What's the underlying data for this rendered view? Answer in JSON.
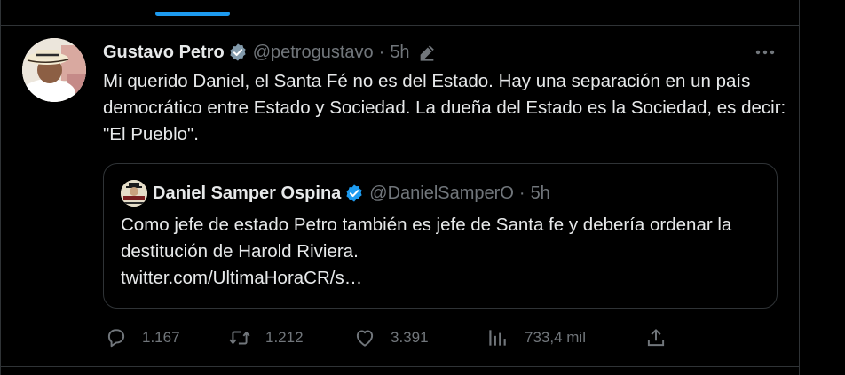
{
  "tweet": {
    "author_name": "Gustavo Petro",
    "handle": "@petrogustavo",
    "separator": "·",
    "time": "5h",
    "text": "Mi querido Daniel, el Santa Fé no es del Estado. Hay una separación en un país democrático entre Estado y Sociedad. La dueña del Estado es la Sociedad, es decir: \"El Pueblo\".",
    "icons": {
      "verified": "verified-badge-icon",
      "edited": "edit-pencil-icon",
      "more": "more-options-icon"
    }
  },
  "quote": {
    "author_name": "Daniel Samper Ospina",
    "handle": "@DanielSamperO",
    "separator": "·",
    "time": "5h",
    "text": "Como jefe de estado Petro también es jefe de Santa fe y debería ordenar la destitución de Harold Riviera.",
    "link": "twitter.com/UltimaHoraCR/s…"
  },
  "actions": {
    "replies": "1.167",
    "retweets": "1.212",
    "likes": "3.391",
    "views": "733,4 mil",
    "icons": [
      "reply-icon",
      "retweet-icon",
      "like-icon",
      "views-icon",
      "share-icon"
    ]
  },
  "colors": {
    "background": "#000000",
    "text": "#e7e9ea",
    "muted": "#71767b",
    "accent": "#1d9bf0",
    "border": "#2f3336"
  }
}
